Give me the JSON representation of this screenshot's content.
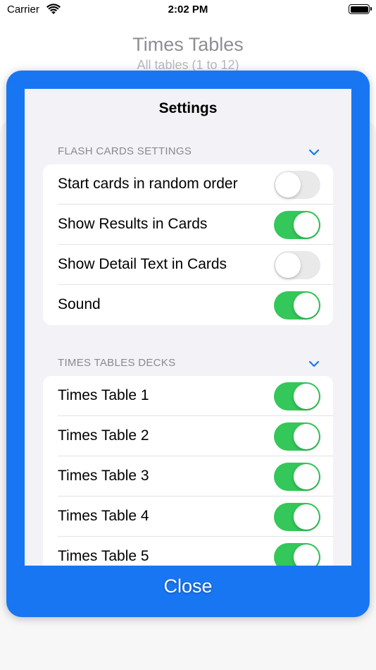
{
  "status_bar": {
    "carrier": "Carrier",
    "time": "2:02 PM"
  },
  "background": {
    "title": "Times Tables",
    "subtitle": "All tables (1 to 12)"
  },
  "settings": {
    "title": "Settings",
    "flash_cards": {
      "header": "FLASH CARDS SETTINGS",
      "rows": [
        {
          "label": "Start cards in random order",
          "on": false
        },
        {
          "label": "Show Results in Cards",
          "on": true
        },
        {
          "label": "Show Detail Text in Cards",
          "on": false
        },
        {
          "label": "Sound",
          "on": true
        }
      ]
    },
    "decks": {
      "header": "TIMES TABLES DECKS",
      "rows": [
        {
          "label": "Times Table 1",
          "on": true
        },
        {
          "label": "Times Table 2",
          "on": true
        },
        {
          "label": "Times Table 3",
          "on": true
        },
        {
          "label": "Times Table 4",
          "on": true
        },
        {
          "label": "Times Table 5",
          "on": true
        }
      ]
    }
  },
  "close_label": "Close",
  "colors": {
    "modal": "#1976f2",
    "toggle_on": "#34c759",
    "toggle_off": "#e9e9ea",
    "chevron": "#1976f2"
  },
  "icons": {
    "wifi": "wifi-icon",
    "battery": "battery-icon",
    "chevron": "chevron-down-icon"
  }
}
